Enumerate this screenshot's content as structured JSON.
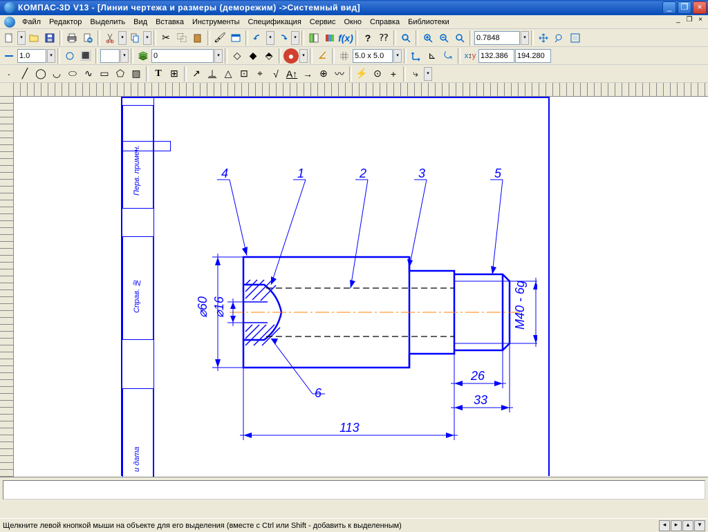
{
  "title": "КОМПАС-3D V13 - [Линии чертежа и размеры (деморежим) ->Системный вид]",
  "menus": [
    "Файл",
    "Редактор",
    "Выделить",
    "Вид",
    "Вставка",
    "Инструменты",
    "Спецификация",
    "Сервис",
    "Окно",
    "Справка",
    "Библиотеки"
  ],
  "toolbar": {
    "zoom_value": "0.7848",
    "line_width": "1.0",
    "layer_value": "0",
    "grid_value": "5.0 x 5.0",
    "coord_x": "132.386",
    "coord_y": "194.280"
  },
  "side_labels": {
    "perv": "Перв. примен.",
    "sprav": "Справ. №",
    "data": "и дата"
  },
  "callouts": {
    "c1": "1",
    "c2": "2",
    "c3": "3",
    "c4": "4",
    "c5": "5",
    "c6": "6"
  },
  "dims": {
    "d60": "⌀60",
    "d16": "⌀16",
    "m40": "M40 - 6g",
    "l113": "113",
    "l33": "33",
    "l26": "26"
  },
  "status": "Щелкните левой кнопкой мыши на объекте для его выделения (вместе с Ctrl или Shift - добавить к выделенным)"
}
